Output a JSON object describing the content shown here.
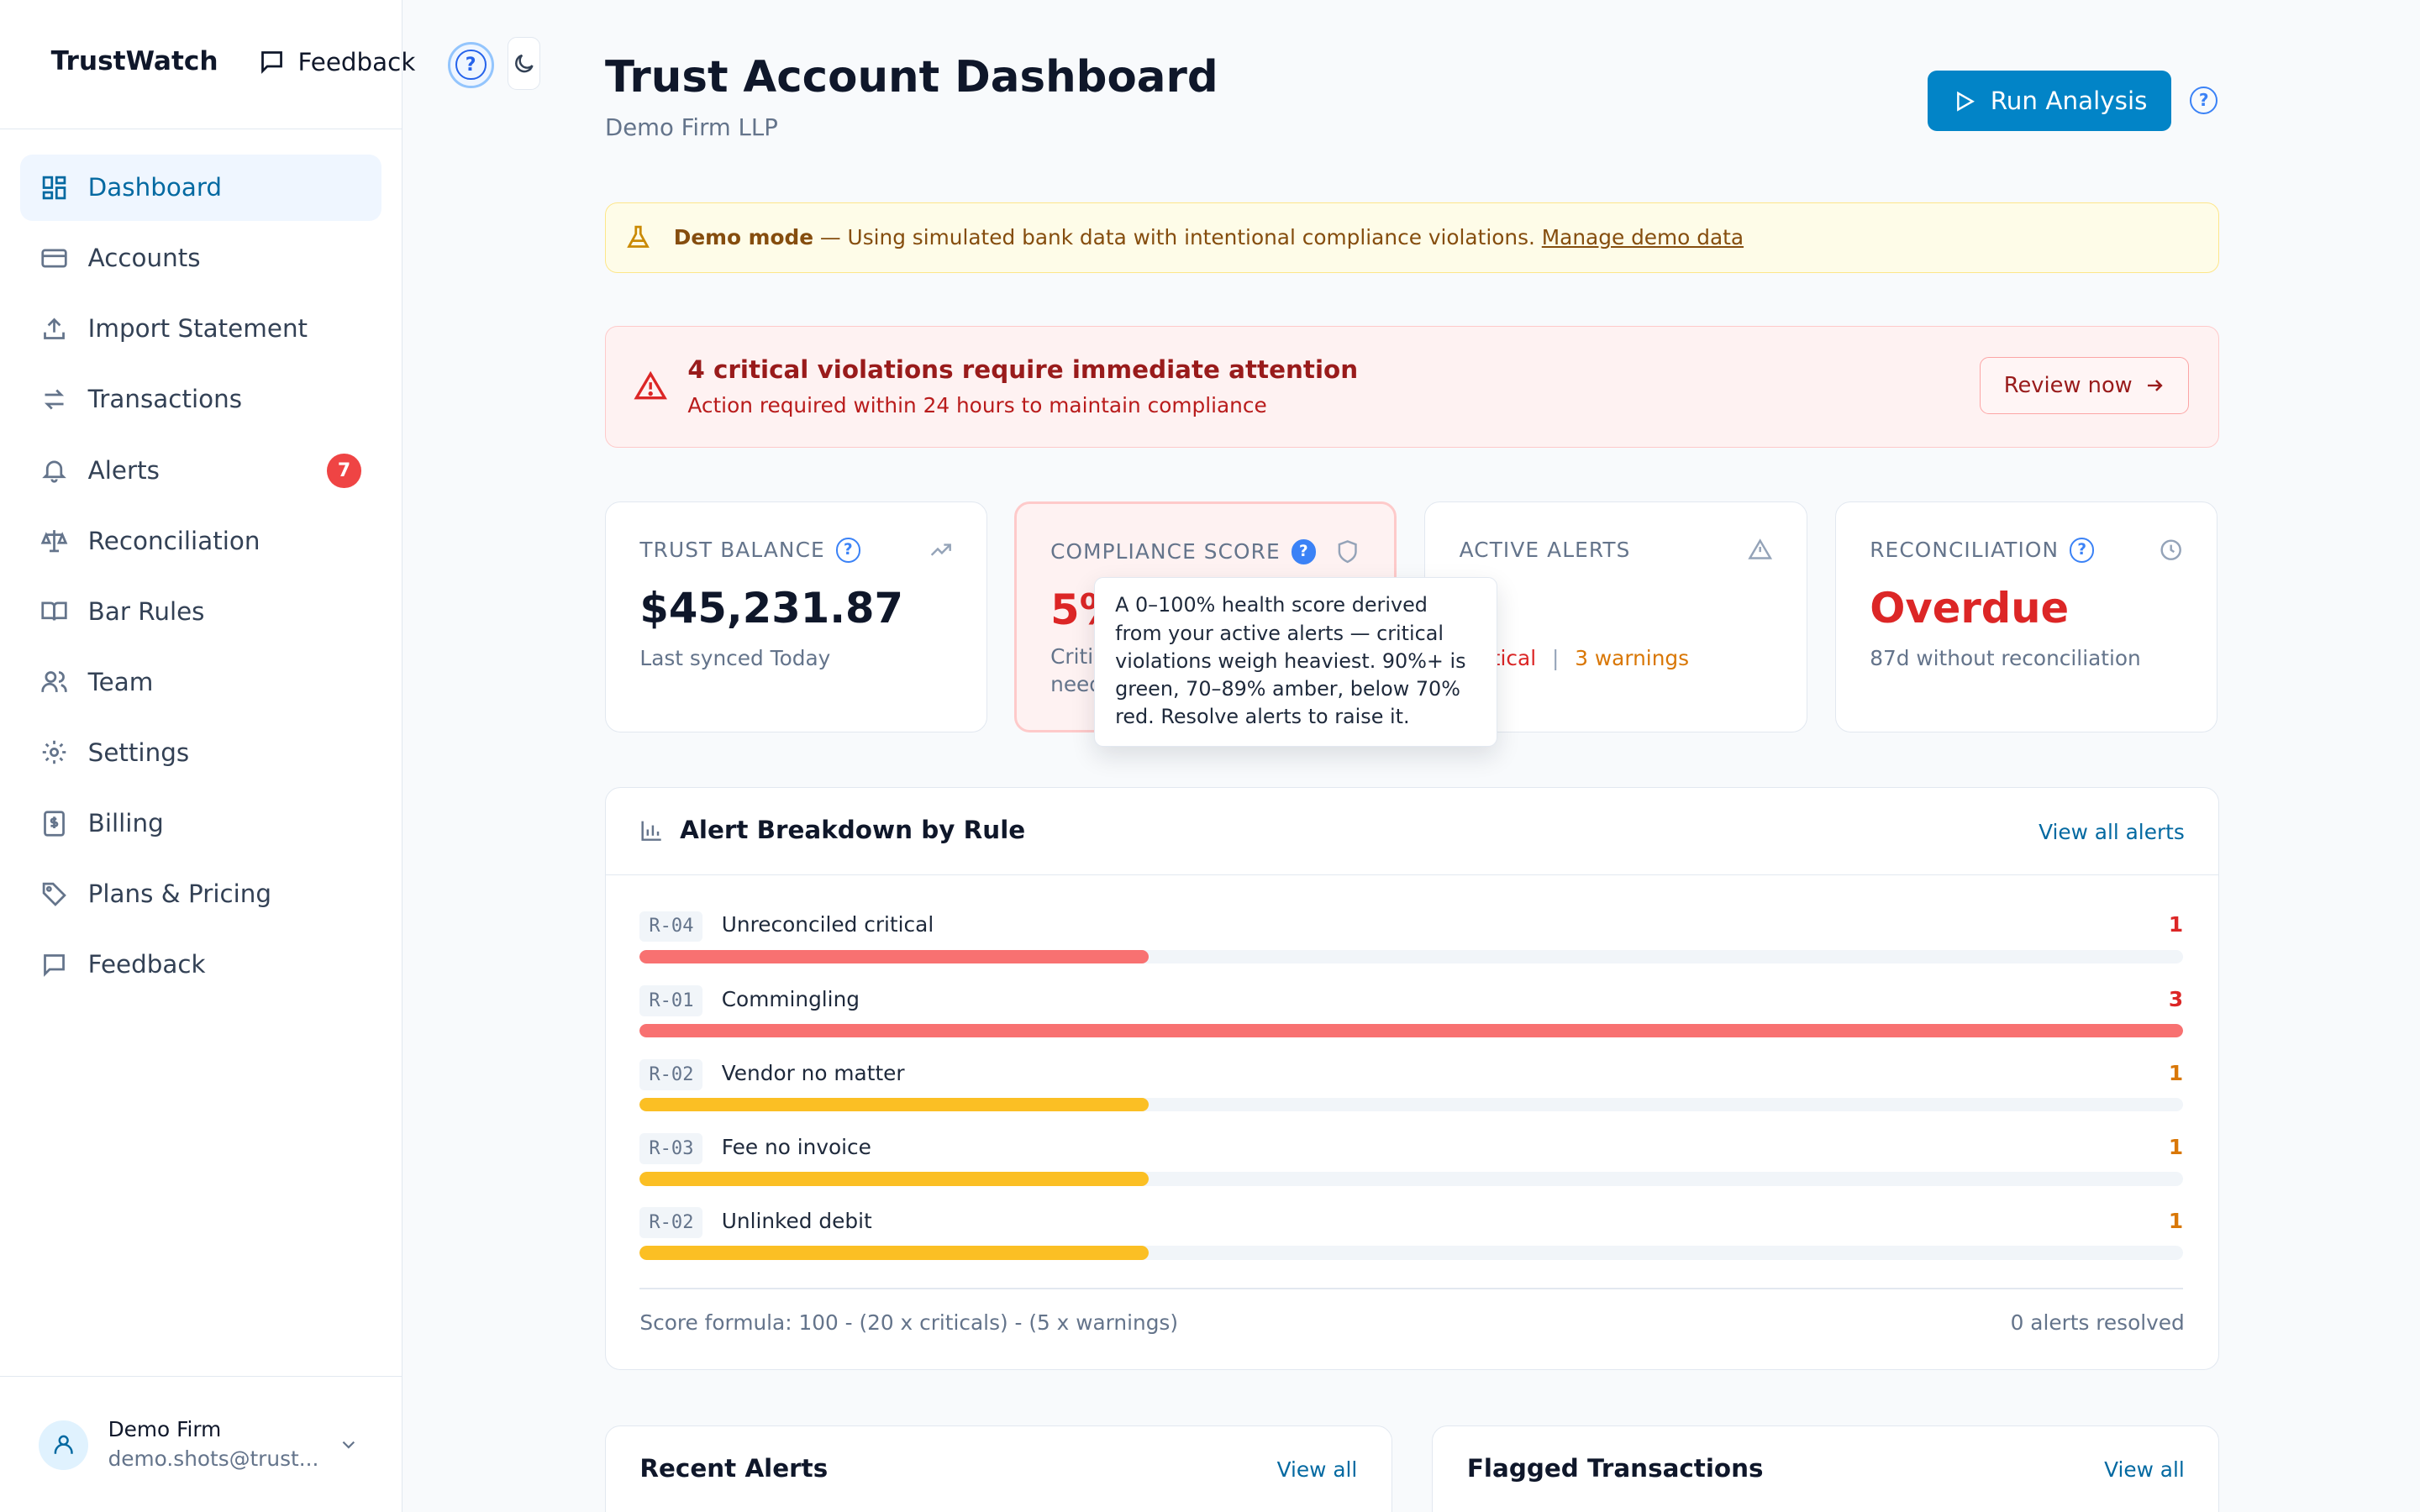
{
  "app": {
    "brand": "TrustWatch",
    "top_feedback": "Feedback"
  },
  "sidebar": {
    "items": [
      {
        "label": "Dashboard",
        "icon": "dashboard-icon",
        "active": true
      },
      {
        "label": "Accounts",
        "icon": "credit-card-icon"
      },
      {
        "label": "Import Statement",
        "icon": "upload-icon"
      },
      {
        "label": "Transactions",
        "icon": "arrows-icon"
      },
      {
        "label": "Alerts",
        "icon": "bell-icon",
        "badge": "7"
      },
      {
        "label": "Reconciliation",
        "icon": "scale-icon"
      },
      {
        "label": "Bar Rules",
        "icon": "book-icon"
      },
      {
        "label": "Team",
        "icon": "users-icon"
      },
      {
        "label": "Settings",
        "icon": "gear-icon"
      },
      {
        "label": "Billing",
        "icon": "receipt-icon"
      },
      {
        "label": "Plans & Pricing",
        "icon": "tag-icon"
      },
      {
        "label": "Feedback",
        "icon": "message-icon"
      }
    ],
    "user": {
      "name": "Demo Firm",
      "email": "demo.shots@trust..."
    }
  },
  "header": {
    "title": "Trust Account Dashboard",
    "subtitle": "Demo Firm LLP",
    "run_label": "Run Analysis",
    "help": "?"
  },
  "demo_banner": {
    "strong": "Demo mode",
    "text": " — Using simulated bank data with intentional compliance violations. ",
    "link": "Manage demo data"
  },
  "critical_banner": {
    "title": "4 critical violations require immediate attention",
    "subtitle": "Action required within 24 hours to maintain compliance",
    "button": "Review now"
  },
  "kpis": {
    "balance": {
      "label": "TRUST BALANCE",
      "value": "$45,231.87",
      "sub": "Last synced Today"
    },
    "compliance": {
      "label": "COMPLIANCE SCORE",
      "value": "5%",
      "sub": "Criti",
      "sub2": "need"
    },
    "alerts": {
      "label": "ACTIVE ALERTS",
      "critical_fragment": "ritical",
      "separator": "|",
      "warnings": "3 warnings"
    },
    "reconciliation": {
      "label": "RECONCILIATION",
      "value": "Overdue",
      "sub": "87d without reconciliation"
    }
  },
  "tooltip": {
    "text": "A 0–100% health score derived from your active alerts — critical violations weigh heaviest. 90%+ is green, 70–89% amber, below 70% red. Resolve alerts to raise it."
  },
  "breakdown": {
    "title": "Alert Breakdown by Rule",
    "link": "View all alerts",
    "rules": [
      {
        "code": "R-04",
        "name": "Unreconciled critical",
        "count": "1",
        "fill_fraction": 0.33,
        "severity": "critical"
      },
      {
        "code": "R-01",
        "name": "Commingling",
        "count": "3",
        "fill_fraction": 1.0,
        "severity": "critical"
      },
      {
        "code": "R-02",
        "name": "Vendor no matter",
        "count": "1",
        "fill_fraction": 0.33,
        "severity": "warning"
      },
      {
        "code": "R-03",
        "name": "Fee no invoice",
        "count": "1",
        "fill_fraction": 0.33,
        "severity": "warning"
      },
      {
        "code": "R-02",
        "name": "Unlinked debit",
        "count": "1",
        "fill_fraction": 0.33,
        "severity": "warning"
      }
    ],
    "formula": "Score formula: 100 - (20 x criticals) - (5 x warnings)",
    "resolved": "0 alerts resolved"
  },
  "bottom_cards": {
    "recent": {
      "title": "Recent Alerts",
      "link": "View all"
    },
    "flagged": {
      "title": "Flagged Transactions",
      "link": "View all"
    }
  },
  "colors": {
    "accent": "#0284c7",
    "critical": "#dc2626",
    "critical_bar": "#f87171",
    "warning_bar": "#fbbf24",
    "warning_text": "#d97706"
  }
}
